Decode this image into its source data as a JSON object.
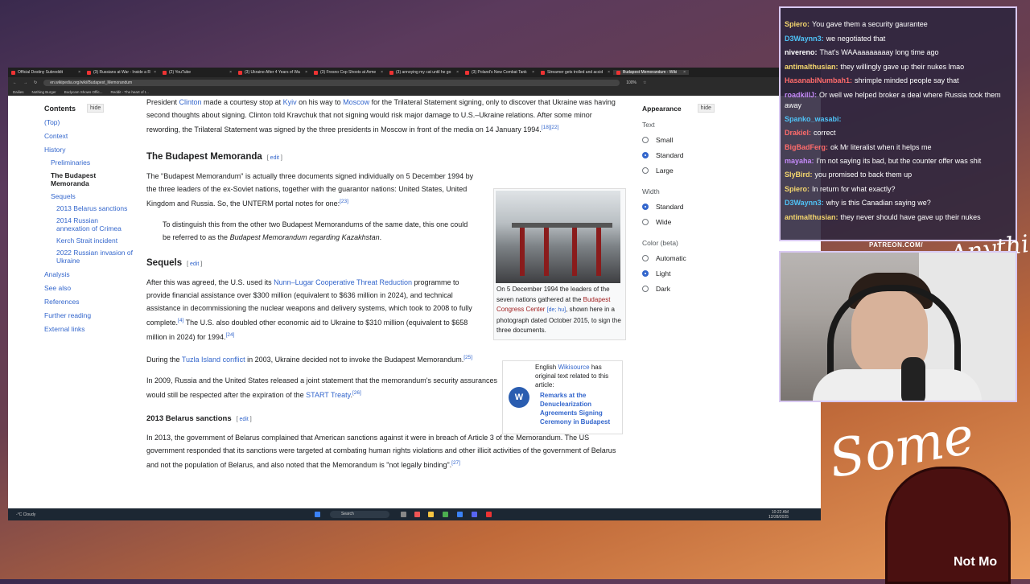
{
  "browser": {
    "tabs": [
      {
        "label": "Official Destiny Subreddit",
        "active": false
      },
      {
        "label": "(3) Russians at War - Inside a R",
        "active": false
      },
      {
        "label": "(2) YouTube",
        "active": false
      },
      {
        "label": "(3) Ukraine After 4 Years of Wa",
        "active": false
      },
      {
        "label": "(3) Fresno Cop Shoots at Arme",
        "active": false
      },
      {
        "label": "(3) annoying my cat until he go",
        "active": false
      },
      {
        "label": "(3) Poland's New Combat Tank",
        "active": false
      },
      {
        "label": "Streamer gets trolled and accid",
        "active": false
      },
      {
        "label": "Budapest Memorandum - Wiki",
        "active": true
      }
    ],
    "url": "en.wikipedia.org/wiki/Budapest_Memorandum",
    "zoom": "100%",
    "bookmarks": [
      "Dailies",
      "Nothing Burger",
      "Bodycam Shows Offic...",
      "Reddit - The heart of t..."
    ]
  },
  "toc": {
    "title": "Contents",
    "hide": "hide",
    "items": [
      {
        "label": "(Top)",
        "level": 1
      },
      {
        "label": "Context",
        "level": 1
      },
      {
        "label": "History",
        "level": 1
      },
      {
        "label": "Preliminaries",
        "level": 2
      },
      {
        "label": "The Budapest Memoranda",
        "level": 2,
        "current": true
      },
      {
        "label": "Sequels",
        "level": 2
      },
      {
        "label": "2013 Belarus sanctions",
        "level": 3
      },
      {
        "label": "2014 Russian annexation of Crimea",
        "level": 3
      },
      {
        "label": "Kerch Strait incident",
        "level": 3
      },
      {
        "label": "2022 Russian invasion of Ukraine",
        "level": 3
      },
      {
        "label": "Analysis",
        "level": 1
      },
      {
        "label": "See also",
        "level": 1
      },
      {
        "label": "References",
        "level": 1
      },
      {
        "label": "Further reading",
        "level": 1
      },
      {
        "label": "External links",
        "level": 1
      }
    ]
  },
  "article": {
    "p0": {
      "t1": "President ",
      "l1": "Clinton",
      "t2": " made a courtesy stop at ",
      "l2": "Kyiv",
      "t3": " on his way to ",
      "l3": "Moscow",
      "t4": " for the Trilateral Statement signing, only to discover that Ukraine was having second thoughts about signing. Clinton told Kravchuk that not signing would risk major damage to U.S.–Ukraine relations. After some minor rewording, the Trilateral Statement was signed by the three presidents in Moscow in front of the media on 14 January 1994.",
      "ref": "[18][22]"
    },
    "h_memoranda": "The Budapest Memoranda",
    "edit": "edit",
    "p1": {
      "text": "The \"Budapest Memorandum\" is actually three documents signed individually on 5 December 1994 by the three leaders of the ex-Soviet nations, together with the guarantor nations: United States, United Kingdom and Russia. So, the UNTERM portal notes for one:",
      "ref": "[23]"
    },
    "quote": {
      "text": "To distinguish this from the other two Budapest Memorandums of the same date, this one could be referred to as the ",
      "italic": "Budapest Memorandum regarding Kazakhstan",
      "end": "."
    },
    "h_sequels": "Sequels",
    "p2": {
      "t1": "After this was agreed, the U.S. used its ",
      "l1": "Nunn–Lugar Cooperative Threat Reduction",
      "t2": " programme to provide financial assistance over $300 million (equivalent to $636 million in 2024), and technical assistance in decommissioning the nuclear weapons and delivery systems, which took to 2008 to fully complete.",
      "ref1": "[4]",
      "t3": " The U.S. also doubled other economic aid to Ukraine to $310 million (equivalent to $658 million in 2024) for 1994.",
      "ref2": "[24]"
    },
    "p3": {
      "t1": "During the ",
      "l1": "Tuzla Island conflict",
      "t2": " in 2003, Ukraine decided not to invoke the Budapest Memorandum.",
      "ref": "[25]"
    },
    "p4": {
      "t1": "In 2009, Russia and the United States released a joint statement that the memorandum's security assurances would still be respected after the expiration of the ",
      "l1": "START Treaty",
      "t2": ".",
      "ref": "[26]"
    },
    "h_belarus": "2013 Belarus sanctions",
    "p5": {
      "text": "In 2013, the government of Belarus complained that American sanctions against it were in breach of Article 3 of the Memorandum. The US government responded that its sanctions were targeted at combating human rights violations and other illicit activities of the government of Belarus and not the population of Belarus, and also noted that the Memorandum is \"not legally binding\".",
      "ref": "[27]"
    }
  },
  "figure": {
    "caption1": "On 5 December 1994 the leaders of the seven nations gathered at the ",
    "link": "Budapest Congress Center",
    "langs": "[de; hu]",
    "caption2": ", shown here in a photograph dated October 2015, to sign the three documents."
  },
  "wikisource": {
    "line1": "English ",
    "link": "Wikisource",
    "line2": " has original text related to this article:",
    "title": "Remarks at the Denuclearization Agreements Signing Ceremony in Budapest",
    "logo_text": "W"
  },
  "appearance": {
    "title": "Appearance",
    "hide": "hide",
    "text_label": "Text",
    "text_options": [
      "Small",
      "Standard",
      "Large"
    ],
    "text_selected": "Standard",
    "width_label": "Width",
    "width_options": [
      "Standard",
      "Wide"
    ],
    "width_selected": "Standard",
    "color_label": "Color (beta)",
    "color_options": [
      "Automatic",
      "Light",
      "Dark"
    ],
    "color_selected": "Light"
  },
  "taskbar": {
    "weather": "-°C Cloudy",
    "search": "Search",
    "time": "10:22 AM",
    "date": "12/28/2025"
  },
  "chat": {
    "messages": [
      {
        "user": "Spiero:",
        "text": "You gave them a security gaurantee",
        "color": "#f5d76e"
      },
      {
        "user": "D3Waynn3:",
        "text": "we negotiated that",
        "color": "#4fc3f7"
      },
      {
        "user": "nivereno:",
        "text": "That's WAAaaaaaaaay long time ago",
        "color": "#ffffff"
      },
      {
        "user": "antimalthusian:",
        "text": "they willingly gave up their nukes lmao",
        "color": "#f5d76e"
      },
      {
        "user": "HasanabiNumbah1:",
        "text": "shrimple minded people say that",
        "color": "#ff6b6b"
      },
      {
        "user": "roadkillJ:",
        "text": "Or well we helped broker a deal where Russia took them away",
        "color": "#c58af9"
      },
      {
        "user": "Spanko_wasabi:",
        "text": "",
        "color": "#4fc3f7"
      },
      {
        "user": "Drakiel:",
        "text": "correct",
        "color": "#ff6b6b"
      },
      {
        "user": "BigBadFerg:",
        "text": "ok Mr literalist when it helps me",
        "color": "#ff6b6b"
      },
      {
        "user": "mayaha:",
        "text": "I'm not saying its bad, but the counter offer was shit",
        "color": "#c58af9"
      },
      {
        "user": "SlyBird:",
        "text": "you promised to back them up",
        "color": "#f5d76e"
      },
      {
        "user": "Spiero:",
        "text": "In return for what exactly?",
        "color": "#f5d76e"
      },
      {
        "user": "D3Waynn3:",
        "text": "why is this Canadian saying we?",
        "color": "#4fc3f7"
      },
      {
        "user": "antimalthusian:",
        "text": "they never should have gave up their nukes",
        "color": "#f5d76e"
      }
    ]
  },
  "overlay": {
    "patreon": "PATREON.COM/",
    "script1": "Anything",
    "script2": "Some",
    "bottom_text": "Not Mo"
  }
}
